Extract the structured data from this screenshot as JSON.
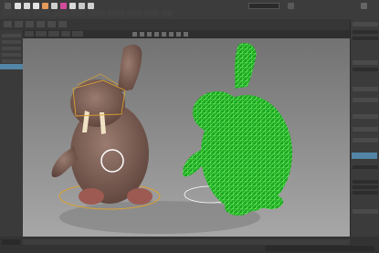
{
  "window": {
    "title": ""
  },
  "toolbar": {
    "search_placeholder": "",
    "buttons": [
      {
        "name": "select-tool",
        "color": "#dfdfdf"
      },
      {
        "name": "move-tool",
        "color": "#d9d9d9"
      },
      {
        "name": "rotate-tool",
        "color": "#e4e4e4"
      },
      {
        "name": "scale-tool",
        "color": "#e39a5b"
      },
      {
        "name": "snap-tool",
        "color": "#cfcfcf"
      },
      {
        "name": "render-tool",
        "color": "#d24b9c"
      },
      {
        "name": "ipr-tool",
        "color": "#d9d9d9"
      },
      {
        "name": "hypershade-tool",
        "color": "#c8c8c8"
      },
      {
        "name": "layout-tool",
        "color": "#cfcfcf"
      }
    ]
  },
  "menubar": {
    "items": [
      "",
      "",
      "",
      "",
      "",
      "",
      "",
      "",
      "",
      ""
    ]
  },
  "viewport": {
    "menu": [
      "",
      "",
      "",
      "",
      ""
    ],
    "background_color": "#8a8a8a",
    "rig_color": "#d9a133",
    "wireframe_color": "#1fe01f",
    "selected_mesh": "walrus-wireframe"
  },
  "colors": {
    "selection": "#5285a6",
    "panel": "#3b3b3b"
  },
  "attribute_editor": {
    "sections": [
      "",
      "",
      "",
      "",
      "",
      "",
      "",
      ""
    ]
  },
  "timeline": {
    "range_start": "",
    "range_end": ""
  }
}
